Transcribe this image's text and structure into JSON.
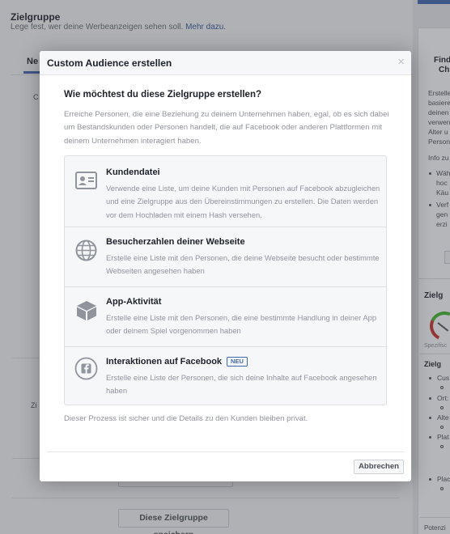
{
  "background": {
    "section_title": "Zielgruppe",
    "section_subtitle": "Lege fest, wer deine Werbeanzeigen sehen soll.",
    "more_link": "Mehr dazu.",
    "tab_label": "Ne",
    "partial_label_1": "C",
    "partial_label_2": "Zi",
    "save_button": "Diese Zielgruppe speichern",
    "right_panel": {
      "title_1": "Find",
      "title_2": "Ch",
      "body_lines": [
        "Erstelle",
        "basiere",
        "deinen",
        "verwen",
        "Alter u",
        "Person"
      ],
      "info_line": "Info zu",
      "bullet_1_lines": [
        "Wäh",
        "hoc",
        "Käu"
      ],
      "bullet_2_lines": [
        "Verf",
        "gen",
        "erzi"
      ],
      "audience_title": "Zielg",
      "spec_label": "Spezifisc",
      "section2_title": "Zielg",
      "items": [
        "Cus",
        "Ort:",
        "Alte",
        "Plat",
        "Plac"
      ],
      "potential": "Potenzi"
    }
  },
  "modal": {
    "title": "Custom Audience erstellen",
    "close_glyph": "×",
    "question": "Wie möchtest du diese Zielgruppe erstellen?",
    "intro": "Erreiche Personen, die eine Beziehung zu deinem Unternehmen haben, egal, ob es sich dabei um Bestandskunden oder Personen handelt, die auf Facebook oder anderen Plattformen mit deinem Unternehmen interagiert haben.",
    "options": [
      {
        "icon": "contact-card-icon",
        "title": "Kundendatei",
        "description": "Verwende eine Liste, um deine Kunden mit Personen auf Facebook abzugleichen und eine Zielgruppe aus den Übereinstimmungen zu erstellen. Die Daten werden vor dem Hochladen mit einem Hash versehen."
      },
      {
        "icon": "globe-icon",
        "title": "Besucherzahlen deiner Webseite",
        "description": "Erstelle eine Liste mit den Personen, die deine Webseite besucht oder bestimmte Webseiten angesehen haben"
      },
      {
        "icon": "cube-icon",
        "title": "App-Aktivität",
        "description": "Erstelle eine Liste mit den Personen, die eine bestimmte Handlung in deiner App oder deinem Spiel vorgenommen haben"
      },
      {
        "icon": "facebook-icon",
        "title": "Interaktionen auf Facebook",
        "badge": "NEU",
        "description": "Erstelle eine Liste der Personen, die sich deine Inhalte auf Facebook angesehen haben"
      }
    ],
    "secure_note": "Dieser Prozess ist sicher und die Details zu den Kunden bleiben privat.",
    "cancel_button": "Abbrechen"
  },
  "colors": {
    "accent": "#4267b2",
    "muted_text": "#90949c",
    "header_bg": "#f6f7f9"
  }
}
